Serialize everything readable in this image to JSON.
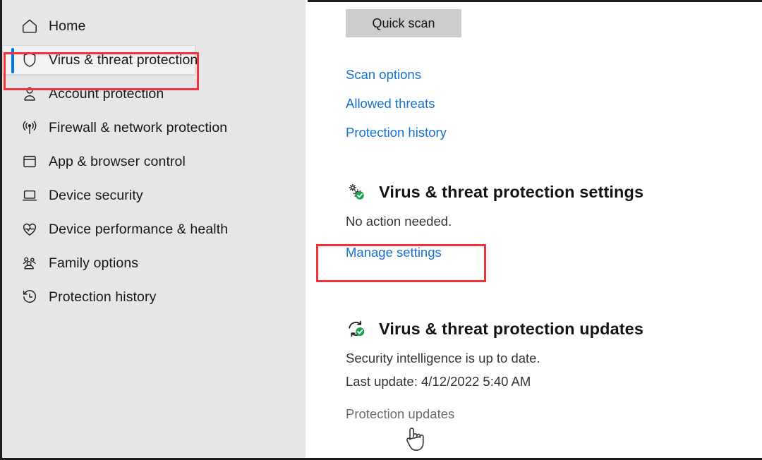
{
  "sidebar": {
    "items": [
      {
        "label": "Home",
        "icon": "home-icon",
        "selected": false
      },
      {
        "label": "Virus & threat protection",
        "icon": "shield-icon",
        "selected": true
      },
      {
        "label": "Account protection",
        "icon": "person-icon",
        "selected": false
      },
      {
        "label": "Firewall & network protection",
        "icon": "wifi-signal-icon",
        "selected": false
      },
      {
        "label": "App & browser control",
        "icon": "app-window-icon",
        "selected": false
      },
      {
        "label": "Device security",
        "icon": "laptop-icon",
        "selected": false
      },
      {
        "label": "Device performance & health",
        "icon": "heart-pulse-icon",
        "selected": false
      },
      {
        "label": "Family options",
        "icon": "people-group-icon",
        "selected": false
      },
      {
        "label": "Protection history",
        "icon": "clock-history-icon",
        "selected": false
      }
    ]
  },
  "main": {
    "quick_scan_label": "Quick scan",
    "links": [
      {
        "label": "Scan options"
      },
      {
        "label": "Allowed threats"
      },
      {
        "label": "Protection history"
      }
    ],
    "settings_section": {
      "title": "Virus & threat protection settings",
      "icon": "gears-check-icon",
      "status": "No action needed.",
      "link": "Manage settings"
    },
    "updates_section": {
      "title": "Virus & threat protection updates",
      "icon": "sync-check-icon",
      "status": "Security intelligence is up to date.",
      "last_update": "Last update: 4/12/2022 5:40 AM",
      "link": "Protection updates"
    }
  },
  "colors": {
    "accent_blue": "#0078d4",
    "link_blue": "#1572d1",
    "highlight_red": "#f4323c",
    "badge_green": "#17a34a",
    "sidebar_bg": "#e6e6e6"
  },
  "cursor": {
    "type": "hand-pointer-cursor"
  }
}
